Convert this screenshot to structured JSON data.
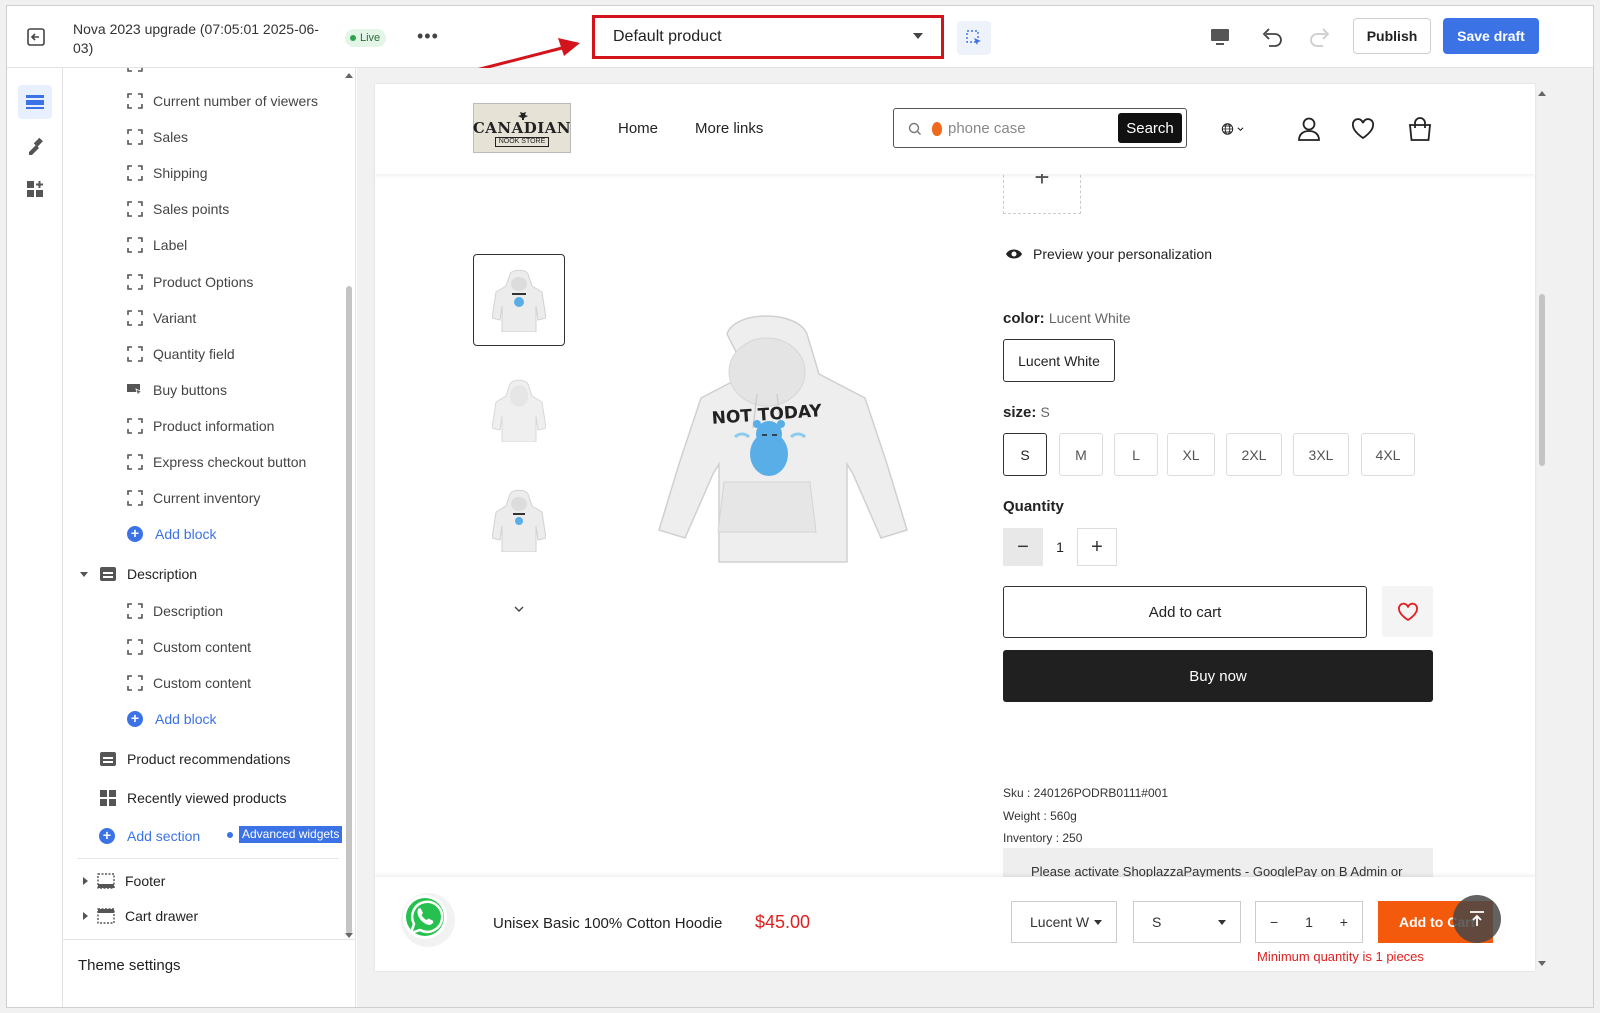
{
  "topbar": {
    "title": "Nova 2023 upgrade (07:05:01 2025-06-03)",
    "status": "Live",
    "template_select": "Default product",
    "publish_label": "Publish",
    "save_label": "Save draft"
  },
  "sidebar": {
    "blocks": [
      {
        "label": "Current number of viewers"
      },
      {
        "label": "Sales"
      },
      {
        "label": "Shipping"
      },
      {
        "label": "Sales points"
      },
      {
        "label": "Label"
      },
      {
        "label": "Product Options"
      },
      {
        "label": "Variant"
      },
      {
        "label": "Quantity field"
      },
      {
        "label": "Buy buttons"
      },
      {
        "label": "Product information"
      },
      {
        "label": "Express checkout button"
      },
      {
        "label": "Current inventory"
      }
    ],
    "add_block_1": "Add block",
    "description_section": "Description",
    "description_blocks": [
      {
        "label": "Description"
      },
      {
        "label": "Custom content"
      },
      {
        "label": "Custom content"
      }
    ],
    "add_block_2": "Add block",
    "product_recommendations": "Product recommendations",
    "recently_viewed": "Recently viewed products",
    "add_section": "Add section",
    "advanced_widgets": "Advanced widgets",
    "footer": "Footer",
    "cart_drawer": "Cart drawer",
    "theme_settings": "Theme settings"
  },
  "store": {
    "logo_line1": "CANADIAN",
    "logo_line2": "NOOK STORE",
    "nav": [
      "Home",
      "More links"
    ],
    "search_placeholder": "phone case",
    "search_button": "Search"
  },
  "product": {
    "preview_personalization": "Preview your personalization",
    "color_label": "color:",
    "color_value": "Lucent White",
    "color_options": [
      "Lucent White"
    ],
    "size_label": "size:",
    "size_value": "S",
    "size_options": [
      "S",
      "M",
      "L",
      "XL",
      "2XL",
      "3XL",
      "4XL"
    ],
    "quantity_label": "Quantity",
    "quantity": "1",
    "add_to_cart": "Add to cart",
    "buy_now": "Buy now",
    "sku": "Sku : 240126PODRB0111#001",
    "weight": "Weight : 560g",
    "inventory": "Inventory : 250",
    "notice": "Please activate ShoplazzaPayments - GooglePay on B Admin or",
    "graphic_text": "NOT TODAY"
  },
  "sticky": {
    "title": "Unisex Basic 100% Cotton Hoodie",
    "price": "$45.00",
    "variant": "Lucent W",
    "size": "S",
    "qty": "1",
    "add": "Add to Cart",
    "min_qty": "Minimum quantity is 1 pieces"
  },
  "colors": {
    "accent": "#3b73e6",
    "annotation": "#d4141c",
    "sticky_add": "#f45a0c",
    "price": "#e02020"
  }
}
